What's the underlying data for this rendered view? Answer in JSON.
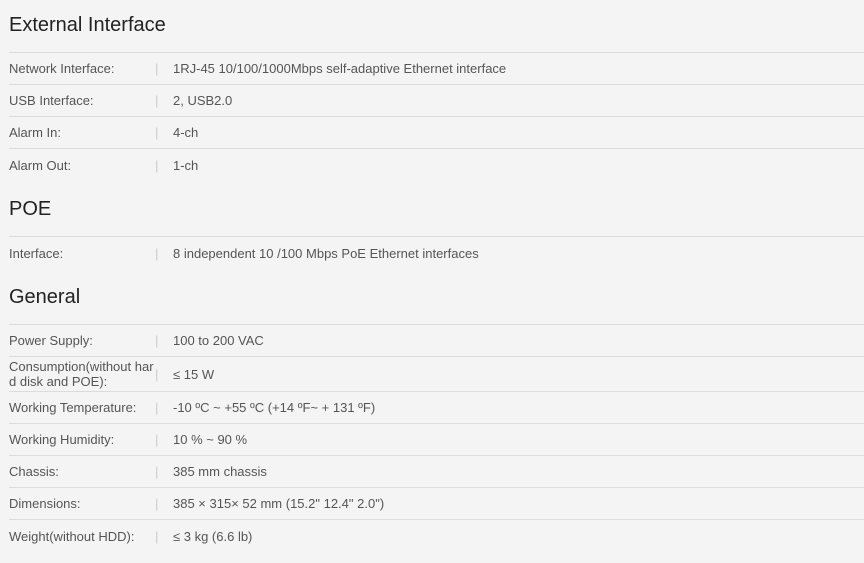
{
  "sections": [
    {
      "title": "External Interface",
      "rows": [
        {
          "label": "Network Interface:",
          "value": "1RJ-45 10/100/1000Mbps self-adaptive Ethernet interface"
        },
        {
          "label": "USB Interface:",
          "value": "2, USB2.0"
        },
        {
          "label": "Alarm In:",
          "value": "4-ch"
        },
        {
          "label": "Alarm Out:",
          "value": "1-ch"
        }
      ]
    },
    {
      "title": "POE",
      "rows": [
        {
          "label": "Interface:",
          "value": "8 independent 10 /100 Mbps PoE Ethernet interfaces"
        }
      ]
    },
    {
      "title": "General",
      "rows": [
        {
          "label": "Power Supply:",
          "value": "100 to 200 VAC"
        },
        {
          "label": "Consumption(without hard disk and POE):",
          "value": "≤ 15 W"
        },
        {
          "label": "Working Temperature:",
          "value": "-10 ºC ~ +55 ºC (+14 ºF~ + 131 ºF)"
        },
        {
          "label": "Working Humidity:",
          "value": "10 % ~ 90 %"
        },
        {
          "label": "Chassis:",
          "value": "385 mm chassis"
        },
        {
          "label": "Dimensions:",
          "value": "385 × 315× 52 mm (15.2\" 12.4\" 2.0\")"
        },
        {
          "label": "Weight(without HDD):",
          "value": "≤ 3 kg (6.6 lb)"
        }
      ]
    }
  ],
  "separator": "|"
}
